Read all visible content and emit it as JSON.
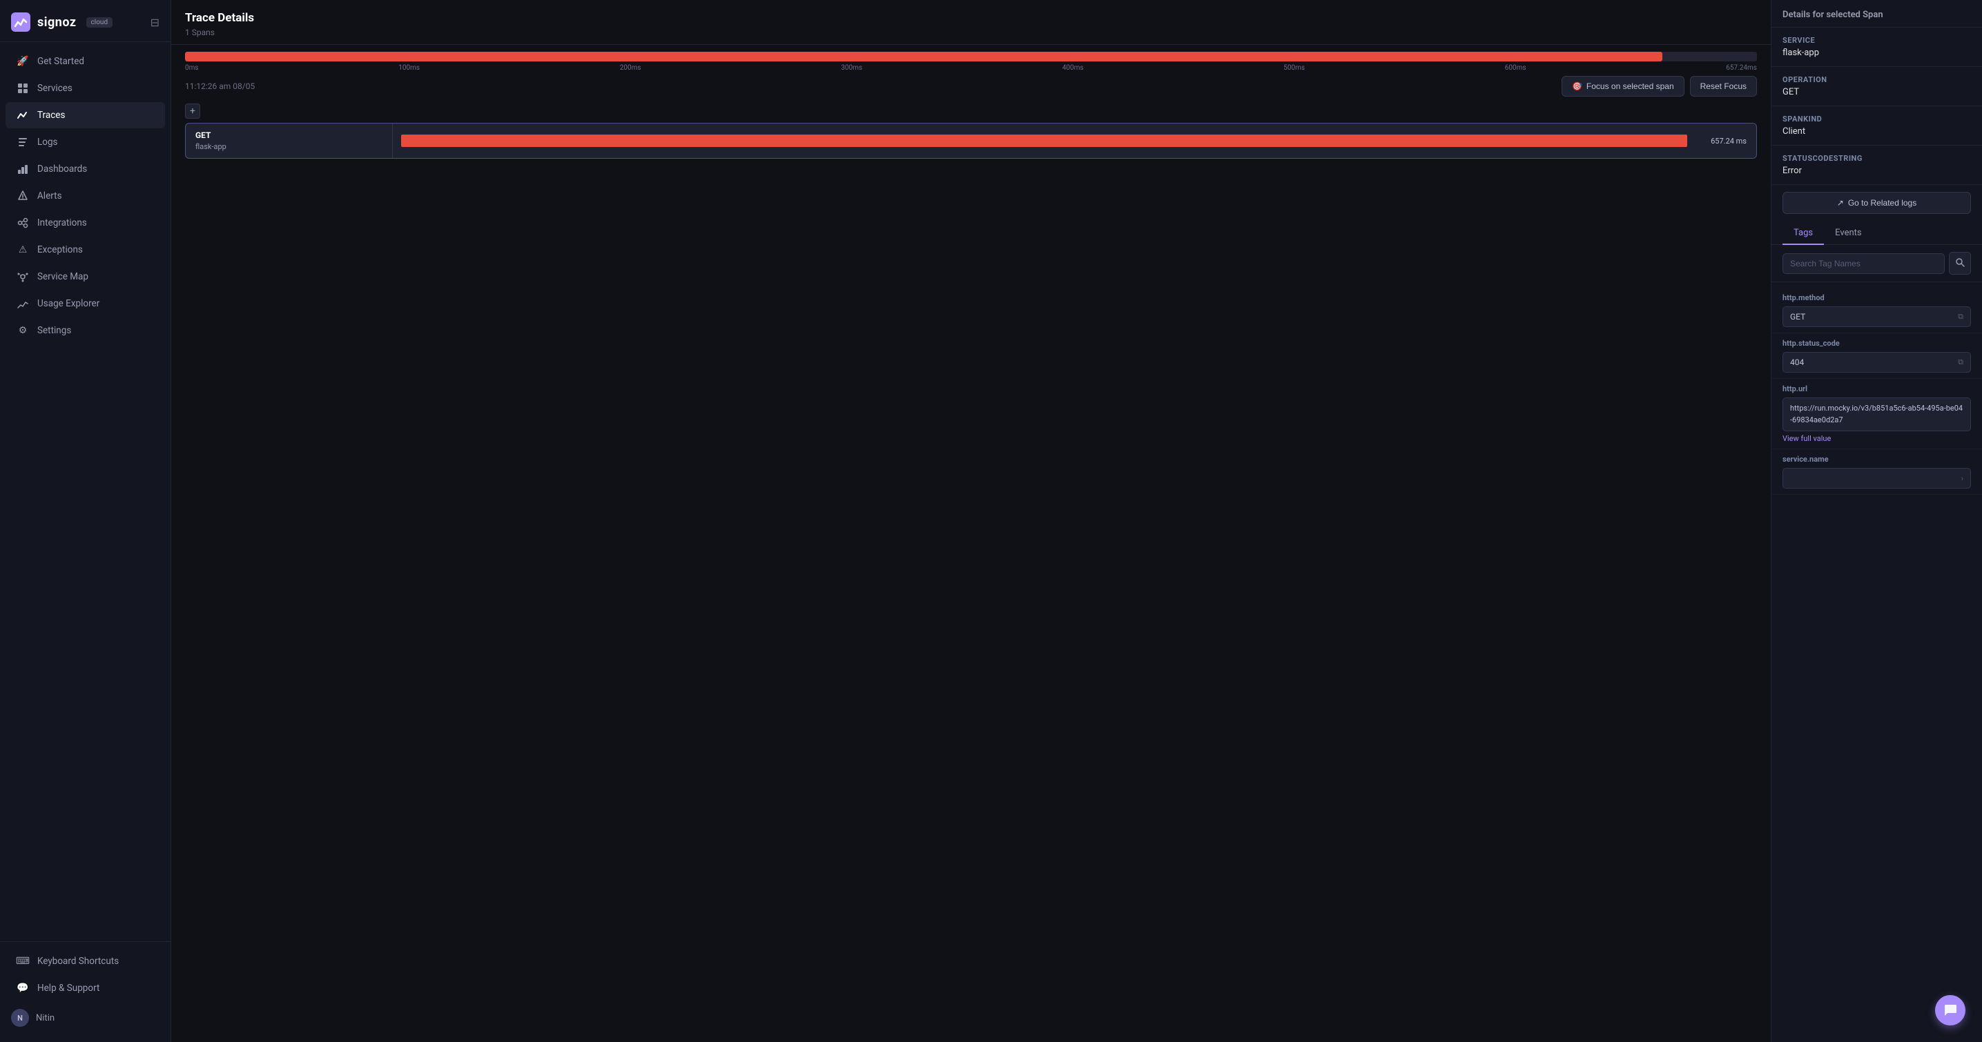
{
  "app": {
    "name": "signoz",
    "badge": "cloud",
    "user": "Nitin"
  },
  "sidebar": {
    "items": [
      {
        "id": "get-started",
        "label": "Get Started",
        "icon": "🚀"
      },
      {
        "id": "services",
        "label": "Services",
        "icon": "⬛"
      },
      {
        "id": "traces",
        "label": "Traces",
        "icon": "📈",
        "active": true
      },
      {
        "id": "logs",
        "label": "Logs",
        "icon": "📋"
      },
      {
        "id": "dashboards",
        "label": "Dashboards",
        "icon": "📊"
      },
      {
        "id": "alerts",
        "label": "Alerts",
        "icon": "🔔"
      },
      {
        "id": "integrations",
        "label": "Integrations",
        "icon": "🔗"
      },
      {
        "id": "exceptions",
        "label": "Exceptions",
        "icon": "⚠"
      },
      {
        "id": "service-map",
        "label": "Service Map",
        "icon": "🗺"
      },
      {
        "id": "usage-explorer",
        "label": "Usage Explorer",
        "icon": "📉"
      },
      {
        "id": "settings",
        "label": "Settings",
        "icon": "⚙"
      }
    ],
    "bottom_items": [
      {
        "id": "keyboard-shortcuts",
        "label": "Keyboard Shortcuts",
        "icon": "⌨"
      },
      {
        "id": "help-support",
        "label": "Help & Support",
        "icon": "💬"
      },
      {
        "id": "user",
        "label": "Nitin",
        "icon": "N"
      }
    ]
  },
  "trace": {
    "title": "Trace Details",
    "spans_count": "1 Spans",
    "timestamp": "11:12:26 am 08/05",
    "timeline_labels": [
      "0ms",
      "100ms",
      "200ms",
      "300ms",
      "400ms",
      "500ms",
      "600ms",
      "657.24ms"
    ],
    "focus_btn": "Focus on selected span",
    "reset_btn": "Reset Focus"
  },
  "span": {
    "method": "GET",
    "service": "flask-app",
    "duration": "657.24 ms",
    "bar_width": "100%"
  },
  "right_panel": {
    "title": "Details for selected Span",
    "service_label": "Service",
    "service_value": "flask-app",
    "operation_label": "Operation",
    "operation_value": "GET",
    "spankind_label": "SpanKind",
    "spankind_value": "Client",
    "status_label": "StatusCodeString",
    "status_value": "Error",
    "go_related_btn": "Go to Related logs",
    "tabs": [
      "Tags",
      "Events"
    ],
    "active_tab": "Tags",
    "search_placeholder": "Search Tag Names",
    "tags": [
      {
        "name": "http.method",
        "value": "GET",
        "multiline": false
      },
      {
        "name": "http.status_code",
        "value": "404",
        "multiline": false
      },
      {
        "name": "http.url",
        "value": "https://run.mocky.io/v3/b851a5c6-ab54-495a-be04-69834ae0d2a7",
        "multiline": true,
        "view_full": "View full value"
      },
      {
        "name": "service.name",
        "value": "",
        "multiline": false
      }
    ]
  }
}
